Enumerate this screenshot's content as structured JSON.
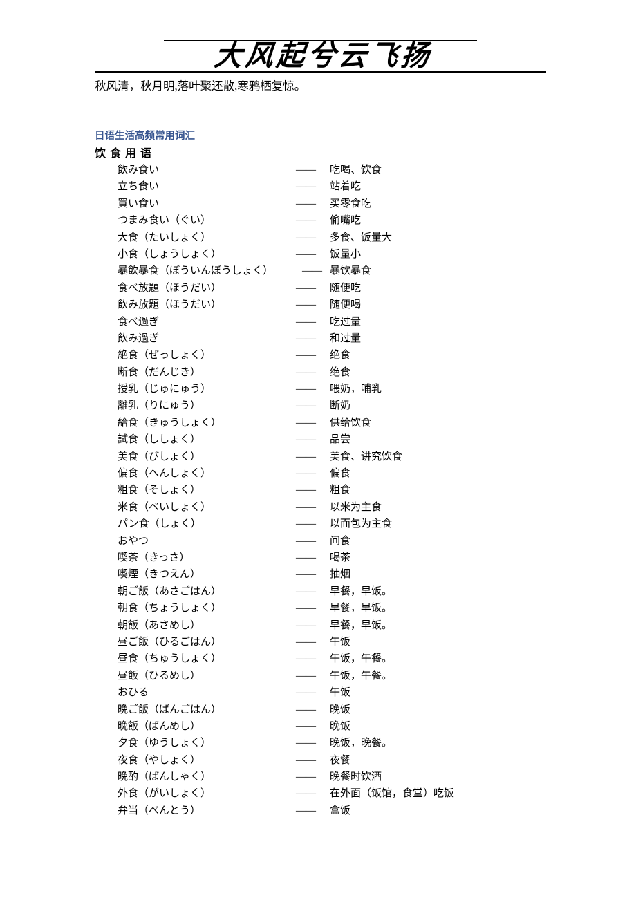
{
  "banner": {
    "title": "大风起兮云飞扬",
    "poem": "秋风清，秋月明,落叶聚还散,寒鸦栖复惊。",
    "title_color": "#000000"
  },
  "section": {
    "title": "日语生活高频常用词汇",
    "title_color": "#36548F",
    "subtitle": "饮食用语"
  },
  "list": {
    "separator": "——",
    "entries": [
      {
        "jp": "飲み食い",
        "zh": "吃喝、饮食",
        "shift": false
      },
      {
        "jp": "立ち食い",
        "zh": "站着吃",
        "shift": false
      },
      {
        "jp": "買い食い",
        "zh": "买零食吃",
        "shift": false
      },
      {
        "jp": "つまみ食い（ぐい）",
        "zh": "偷嘴吃",
        "shift": false
      },
      {
        "jp": "大食（たいしょく）",
        "zh": "多食、饭量大",
        "shift": false
      },
      {
        "jp": "小食（しょうしょく）",
        "zh": "饭量小",
        "shift": false
      },
      {
        "jp": "暴飲暴食（ぼういんぼうしょく）",
        "zh": "暴饮暴食",
        "shift": true
      },
      {
        "jp": "食べ放題（ほうだい）",
        "zh": "随便吃",
        "shift": false
      },
      {
        "jp": "飲み放題（ほうだい）",
        "zh": "随便喝",
        "shift": false
      },
      {
        "jp": "食べ過ぎ",
        "zh": "吃过量",
        "shift": false
      },
      {
        "jp": "飲み過ぎ",
        "zh": "和过量",
        "shift": false
      },
      {
        "jp": "絶食（ぜっしょく）",
        "zh": "绝食",
        "shift": false
      },
      {
        "jp": "断食（だんじき）",
        "zh": "绝食",
        "shift": false
      },
      {
        "jp": "授乳（じゅにゅう）",
        "zh": "喂奶，哺乳",
        "shift": false
      },
      {
        "jp": "離乳（りにゅう）",
        "zh": "断奶",
        "shift": false
      },
      {
        "jp": "給食（きゅうしょく）",
        "zh": "供给饮食",
        "shift": false
      },
      {
        "jp": "試食（ししょく）",
        "zh": "品尝",
        "shift": false
      },
      {
        "jp": "美食（びしょく）",
        "zh": "美食、讲究饮食",
        "shift": false
      },
      {
        "jp": "偏食（へんしょく）",
        "zh": "偏食",
        "shift": false
      },
      {
        "jp": "粗食（そしょく）",
        "zh": "粗食",
        "shift": false
      },
      {
        "jp": "米食（べいしょく）",
        "zh": "以米为主食",
        "shift": false
      },
      {
        "jp": "パン食（しょく）",
        "zh": "以面包为主食",
        "shift": false
      },
      {
        "jp": "おやつ",
        "zh": "间食",
        "shift": false
      },
      {
        "jp": "喫茶（きっさ）",
        "zh": "喝茶",
        "shift": false
      },
      {
        "jp": "喫煙（きつえん）",
        "zh": "抽烟",
        "shift": false
      },
      {
        "jp": "朝ご飯（あさごはん）",
        "zh": "早餐，早饭。",
        "shift": false
      },
      {
        "jp": "朝食（ちょうしょく）",
        "zh": "早餐，早饭。",
        "shift": false
      },
      {
        "jp": "朝飯（あさめし）",
        "zh": "早餐，早饭。",
        "shift": false
      },
      {
        "jp": "昼ご飯（ひるごはん）",
        "zh": "午饭",
        "shift": false
      },
      {
        "jp": "昼食（ちゅうしょく）",
        "zh": "午饭，午餐。",
        "shift": false
      },
      {
        "jp": "昼飯（ひるめし）",
        "zh": "午饭，午餐。",
        "shift": false
      },
      {
        "jp": "おひる",
        "zh": "午饭",
        "shift": false
      },
      {
        "jp": "晩ご飯（ばんごはん）",
        "zh": "晚饭",
        "shift": false
      },
      {
        "jp": "晩飯（ばんめし）",
        "zh": "晚饭",
        "shift": false
      },
      {
        "jp": "夕食（ゆうしょく）",
        "zh": "晚饭，晚餐。",
        "shift": false
      },
      {
        "jp": "夜食（やしょく）",
        "zh": "夜餐",
        "shift": false
      },
      {
        "jp": "晩酌（ばんしゃく）",
        "zh": "晚餐时饮酒",
        "shift": false
      },
      {
        "jp": "外食（がいしょく）",
        "zh": "在外面（饭馆，食堂）吃饭",
        "shift": false
      },
      {
        "jp": "弁当（べんとう）",
        "zh": "盒饭",
        "shift": false
      }
    ]
  }
}
